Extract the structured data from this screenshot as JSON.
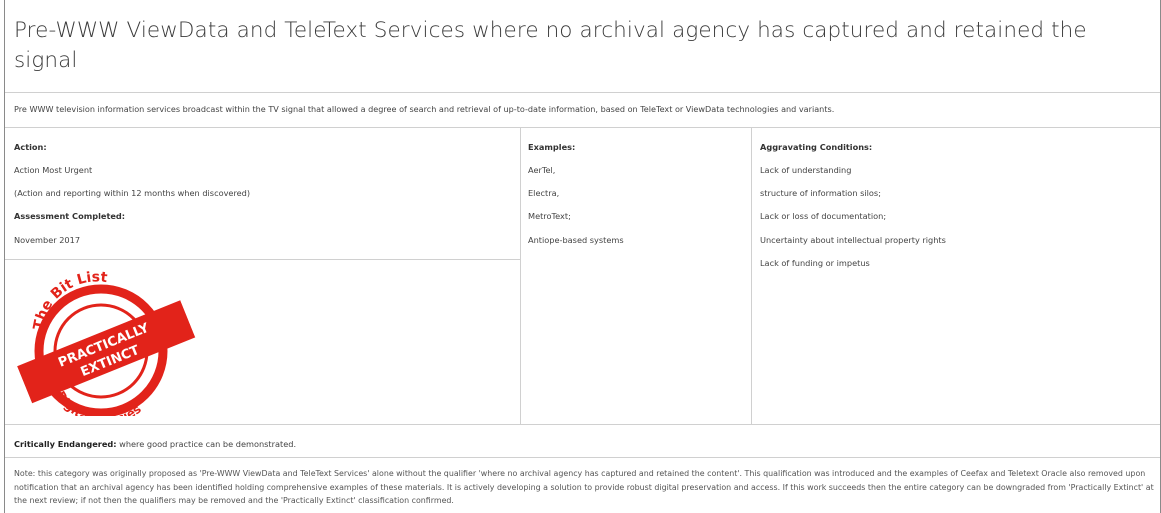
{
  "title": "Pre-WWW ViewData and TeleText Services where no archival agency has captured and retained the signal",
  "intro": "Pre WWW television information services broadcast within the TV signal that allowed a degree of search and retrieval of up-to-date information, based on TeleText or ViewData technologies and variants.",
  "action": {
    "heading": "Action:",
    "level": "Action Most Urgent",
    "timeline": "(Action and reporting within 12 months when discovered)",
    "assessment_heading": "Assessment Completed:",
    "assessment_date": "November 2017"
  },
  "examples": {
    "heading": "Examples:",
    "items": [
      "AerTel,",
      "Electra,",
      "MetroText;",
      "Antiope-based systems"
    ]
  },
  "aggravating": {
    "heading": "Aggravating Conditions:",
    "items": [
      "Lack of understanding",
      "structure of information silos;",
      "Lack or loss of documentation;",
      "Uncertainty about intellectual property rights",
      "Lack of funding or impetus"
    ]
  },
  "stamp": {
    "top_text": "The Bit List",
    "ribbon_line1": "PRACTICALLY",
    "ribbon_line2": "EXTINCT",
    "bottom_text": "Digital Species",
    "color": "#e2231a"
  },
  "critically": {
    "label": "Critically Endangered:",
    "text": " where good practice can be demonstrated."
  },
  "note": "Note: this category was originally proposed as 'Pre-WWW ViewData and TeleText Services' alone without the qualifier 'where no archival agency has captured and retained the content'. This qualification was introduced and the examples of Ceefax and Teletext Oracle also removed upon notification that an archival agency has been identified holding comprehensive examples of these materials. It is actively developing a solution to provide robust digital preservation and access.  If this work succeeds then the entire category can be downgraded from 'Practically Extinct' at the next review; if not then the qualifiers may be removed and the 'Practically Extinct' classification confirmed."
}
